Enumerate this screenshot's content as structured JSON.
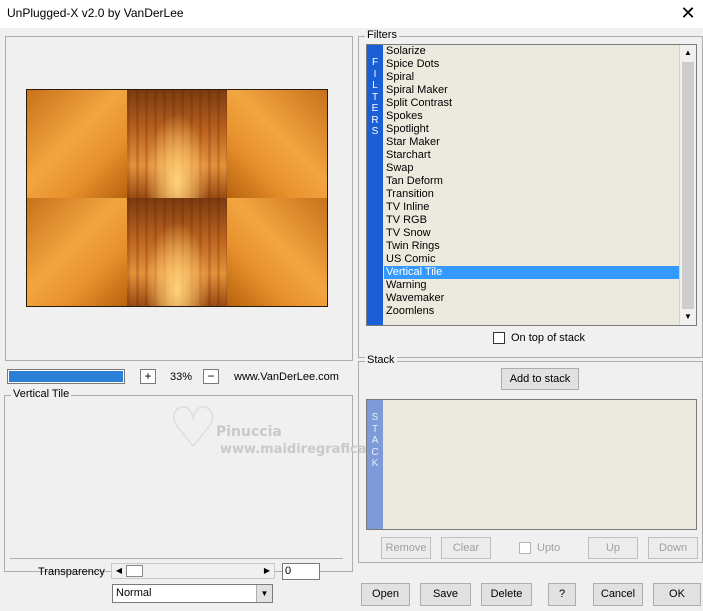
{
  "window": {
    "title": "UnPlugged-X v2.0 by VanDerLee",
    "close_glyph": "✕"
  },
  "preview": {
    "progress_percent": 100,
    "zoom_in_label": "+",
    "zoom_out_label": "−",
    "zoom_level": "33%",
    "website": "www.VanDerLee.com"
  },
  "filters": {
    "group_label": "Filters",
    "strip_letters": [
      "F",
      "I",
      "L",
      "T",
      "E",
      "R",
      "S"
    ],
    "items": [
      "Solarize",
      "Spice Dots",
      "Spiral",
      "Spiral Maker",
      "Split Contrast",
      "Spokes",
      "Spotlight",
      "Star Maker",
      "Starchart",
      "Swap",
      "Tan Deform",
      "Transition",
      "TV Inline",
      "TV RGB",
      "TV Snow",
      "Twin Rings",
      "US Comic",
      "Vertical Tile",
      "Warning",
      "Wavemaker",
      "Zoomlens"
    ],
    "selected": "Vertical Tile",
    "on_top_label": "On top of stack",
    "on_top_checked": false
  },
  "params": {
    "group_label": "Vertical Tile"
  },
  "stack": {
    "group_label": "Stack",
    "add_label": "Add to stack",
    "strip_letters": [
      "S",
      "T",
      "A",
      "C",
      "K"
    ],
    "remove_label": "Remove",
    "clear_label": "Clear",
    "upto_label": "Upto",
    "up_label": "Up",
    "down_label": "Down"
  },
  "transparency": {
    "label": "Transparency",
    "value": "0",
    "slider_fraction": 0,
    "blend_mode": "Normal",
    "left_arrow": "◀",
    "right_arrow": "▶",
    "dropdown_arrow": "▼"
  },
  "scroll_arrows": {
    "up": "▲",
    "down": "▼"
  },
  "buttons": {
    "open": "Open",
    "save": "Save",
    "delete": "Delete",
    "help": "?",
    "cancel": "Cancel",
    "ok": "OK"
  },
  "watermark": {
    "name": "Pinuccia",
    "url": "www.maidiregrafica.eu"
  },
  "colors": {
    "accent": "#3399ff",
    "strip_blue": "#1a5fd6",
    "strip_stack": "#7e9ad8",
    "list_bg": "#ece9df"
  }
}
